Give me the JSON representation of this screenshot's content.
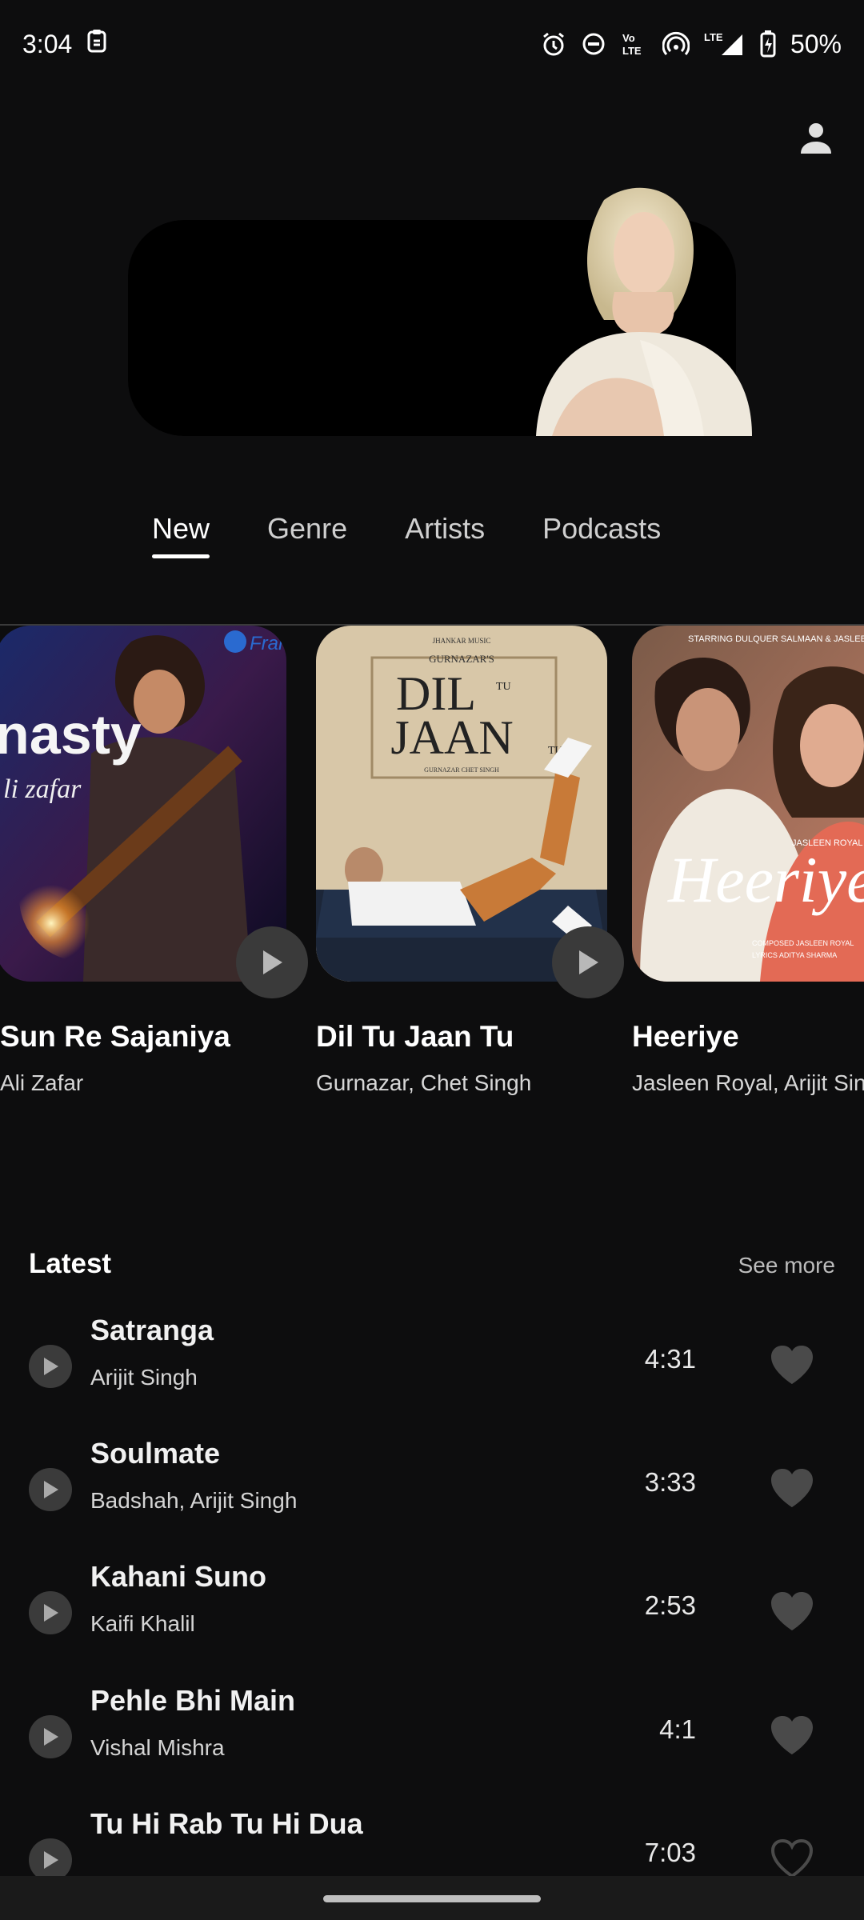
{
  "status_bar": {
    "time": "3:04",
    "battery": "50%",
    "network": "LTE",
    "icons": [
      "clipboard-icon",
      "alarm-icon",
      "do-not-disturb-icon",
      "volte-icon",
      "hotspot-icon",
      "signal-icon",
      "battery-icon"
    ]
  },
  "header": {
    "profile_icon": "person-icon"
  },
  "tabs": [
    {
      "label": "New",
      "active": true
    },
    {
      "label": "Genre",
      "active": false
    },
    {
      "label": "Artists",
      "active": false
    },
    {
      "label": "Podcasts",
      "active": false
    }
  ],
  "featured": [
    {
      "title": "Sun Re Sajaniya",
      "artist": "Ali Zafar",
      "art_text": "nasty",
      "art_subtext": "li zafar",
      "badge_text": "Fran"
    },
    {
      "title": "Dil Tu Jaan Tu",
      "artist": "Gurnazar, Chet Singh",
      "art_label": "GURNAZAR'S",
      "art_text_1": "DIL",
      "art_text_2": "JAAN",
      "art_small": "TU",
      "art_top": "JHANKAR MUSIC",
      "art_credits": "GURNAZAR   CHET SINGH"
    },
    {
      "title": "Heeriye",
      "artist": "Jasleen Royal, Arijit Sing",
      "art_text": "Heeriye",
      "art_top": "STARRING DULQUER SALMAAN & JASLEEN ROYAL",
      "art_sub": "JASLEEN ROYAL FT ARIJIT SIN",
      "art_credits_1": "COMPOSED JASLEEN ROYAL",
      "art_credits_2": "LYRICS ADITYA SHARMA"
    }
  ],
  "latest": {
    "title": "Latest",
    "see_more": "See more",
    "songs": [
      {
        "title": "Satranga",
        "artist": "Arijit Singh",
        "duration": "4:31",
        "liked": true
      },
      {
        "title": "Soulmate",
        "artist": "Badshah, Arijit Singh",
        "duration": "3:33",
        "liked": true
      },
      {
        "title": "Kahani Suno",
        "artist": "Kaifi Khalil",
        "duration": "2:53",
        "liked": true
      },
      {
        "title": "Pehle Bhi Main",
        "artist": "Vishal Mishra",
        "duration": "4:1",
        "liked": true
      },
      {
        "title": "Tu Hi Rab Tu Hi Dua",
        "artist": "",
        "duration": "7:03",
        "liked": false
      }
    ]
  }
}
